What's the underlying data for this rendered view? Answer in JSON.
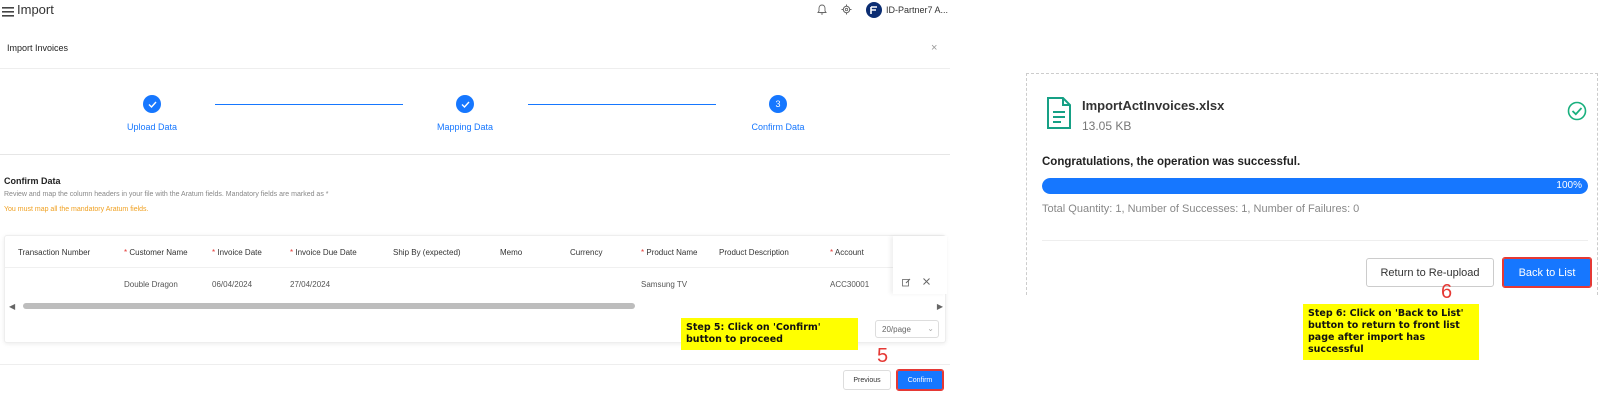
{
  "topbar": {
    "app_title": "Import",
    "user_name": "ID-Partner7 A..."
  },
  "dialog": {
    "title": "Import Invoices",
    "close": "×"
  },
  "stepper": {
    "steps": [
      {
        "label": "Upload Data",
        "state": "done"
      },
      {
        "label": "Mapping Data",
        "state": "done"
      },
      {
        "label": "Confirm Data",
        "number": "3",
        "state": "current"
      }
    ]
  },
  "confirm_section": {
    "title": "Confirm Data",
    "description": "Review and map the column headers in your file with the Aratum fields. Mandatory fields are marked as *",
    "warning": "You must map all the mandatory Aratum fields."
  },
  "table": {
    "headers": [
      {
        "label": "Transaction Number",
        "required": false
      },
      {
        "label": "Customer Name",
        "required": true
      },
      {
        "label": "Invoice Date",
        "required": true
      },
      {
        "label": "Invoice Due Date",
        "required": true
      },
      {
        "label": "Ship By (expected)",
        "required": false
      },
      {
        "label": "Memo",
        "required": false
      },
      {
        "label": "Currency",
        "required": false
      },
      {
        "label": "Product Name",
        "required": true
      },
      {
        "label": "Product Description",
        "required": false
      },
      {
        "label": "Account",
        "required": true
      }
    ],
    "required_mark": "*",
    "row": {
      "transaction_number": "",
      "customer_name": "Double Dragon",
      "invoice_date": "06/04/2024",
      "invoice_due_date": "27/04/2024",
      "ship_by": "",
      "memo": "",
      "currency": "",
      "product_name": "Samsung TV",
      "product_description": "",
      "account": "ACC30001"
    },
    "page_size": "20/page"
  },
  "footer": {
    "previous_label": "Previous",
    "confirm_label": "Confirm"
  },
  "annotations": {
    "step5_text": "Step 5: Click on 'Confirm' button to proceed",
    "step5_number": "5",
    "step6_text": "Step 6: Click on 'Back to List' button to return to front list page after import has successful",
    "step6_number": "6"
  },
  "result": {
    "file_name": "ImportActInvoices.xlsx",
    "file_size": "13.05 KB",
    "message": "Congratulations, the operation was successful.",
    "progress_percent": 100,
    "progress_label": "100%",
    "summary": "Total Quantity: 1, Number of Successes: 1, Number of Failures: 0",
    "reupload_label": "Return to Re-upload",
    "back_label": "Back to List"
  },
  "colors": {
    "primary": "#1677ff",
    "success_icon": "#19b07e",
    "file_icon": "#16a085",
    "required": "#e53935",
    "warning": "#f0a020",
    "callout": "#ffff00"
  },
  "icons": {
    "menu": "menu-icon",
    "bell": "bell-icon",
    "settings": "gear-icon",
    "avatar": "logo-avatar",
    "close": "close-icon",
    "check": "check-icon",
    "edit": "edit-icon",
    "delete": "delete-icon",
    "file": "file-icon",
    "success": "check-circle-icon"
  }
}
